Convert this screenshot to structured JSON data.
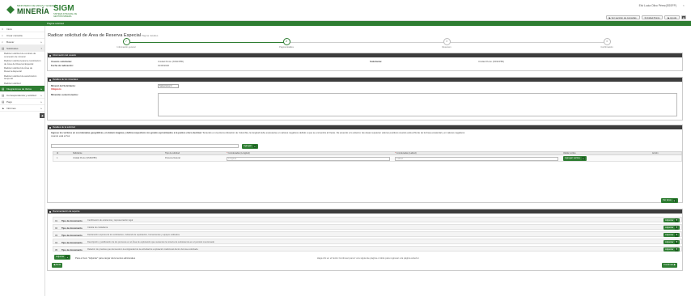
{
  "header": {
    "ministry": "MINISTERIO DE MINAS Y ENERGÍA",
    "brand": "MINERÍA",
    "app": "SIGM",
    "app_sub": "SISTEMA INTEGRAL DE GESTIÓN MINERA",
    "user": "Elvi Lucia Olivo Pérez(SSSFP)",
    "close": "×",
    "actions": [
      "▶ Ver sección de consultas",
      "ℹ Unidad Punto",
      "▶ Ayuda",
      "■"
    ]
  },
  "breadcrumb": "Página solicitud",
  "sidebar": {
    "items": [
      {
        "icon": "⌂",
        "label": "Inicio",
        "chev": ""
      },
      {
        "icon": "⌕",
        "label": "Crear consulta",
        "chev": ""
      },
      {
        "icon": "⌕",
        "label": "Buscar",
        "chev": "▸"
      },
      {
        "icon": "▤",
        "label": "Solicitudes",
        "chev": "▾"
      }
    ],
    "subitems": [
      "Radicar solicitud de contrato de concesión de mineral",
      "Radicar solicitud para la constitución de Área de Reserva Especial",
      "Radicar solicitud de Área de Reserva Especial",
      "Radicar solicitud de autorización temporal",
      "Radicar solicitud"
    ],
    "items2": [
      {
        "icon": "▤",
        "label": "Integraciones de títulos",
        "chev": "▸",
        "highlight": true
      },
      {
        "icon": "▤",
        "label": "Correspondencia y solicitud",
        "chev": "▸"
      },
      {
        "icon": "▤",
        "label": "Pago",
        "chev": "▸"
      },
      {
        "icon": "▲",
        "label": "Informes",
        "chev": "▸"
      }
    ],
    "collapse": "◀"
  },
  "page": {
    "title": "Radicar solicitud de Área de Reserva Especial",
    "subtitle": " Página detalles"
  },
  "stepper": [
    {
      "num": "✓",
      "label": "Información general",
      "done": true
    },
    {
      "num": "2",
      "label": "Página detalles",
      "done": true
    },
    {
      "num": "3",
      "label": "Resumen",
      "done": false
    },
    {
      "num": "4",
      "label": "Confirmación",
      "done": false
    }
  ],
  "info_panel": {
    "title": "Información del usuario",
    "user_label": "Usuario solicitante:",
    "user_value": "Unidad Punto (SSSFP85)",
    "date_label": "Fecha de radicación:",
    "date_value": "01/06/2020",
    "right_label": "Solicitante:",
    "right_value": "Unidad Punto (SSSFP85)"
  },
  "minerals_panel": {
    "title": "Detalles de los minerales",
    "mineral_label": "Mineral del Solicitante:",
    "mineral_req": "Obligatorio",
    "select_text": "Seleccionar ▾",
    "desc_label": "Minerales seleccionados:"
  },
  "area_panel": {
    "title": "Detalles de la solicitud",
    "hint_bold": "Ingrese los vértices en coordenadas geográficas, en datum magnas y defina respectivos los grados aproximados a la puntos cinco decimal.",
    "hint_rest": " Teniendo en cuenta la ubicación de Colombia, la longitud debe expresarse en valores negativos debido a que se encuentra al Oeste. De acuerdo a lo anterior, las áreas requieren valores positivos cuando está al Norte de la línea ecuatorial y en valores negativos cuando está al Sur.",
    "search_btn": "Agregar",
    "columns": [
      "Id",
      "Solicitante",
      "Tipo de solicitud",
      "Coordenadas (Longitud)",
      "Coordenadas (Latitud)",
      "Validar vértice",
      "Acción"
    ],
    "col_req": "Obligatorio",
    "row": {
      "id": "1",
      "name": "Unidad Punto (SSSFP85)",
      "type": "Persona Natural",
      "lon_ph": "Longitud",
      "lat_ph": "Latitud",
      "validate": "Agregar vértice"
    },
    "save_btn": "Ver área"
  },
  "docs_panel": {
    "title": "Documentación de soporte",
    "rows": [
      {
        "num": "01",
        "label": "Tipo de documento",
        "desc": "Certificación de existencia y representación legal",
        "btn": "Adjuntar"
      },
      {
        "num": "02",
        "label": "Tipo de documento",
        "desc": "Cédula de ciudadanía",
        "btn": "Adjuntar"
      },
      {
        "num": "03",
        "label": "Tipo de documento",
        "desc": "Declaración expresa de los solicitantes, indicando la explotación, herramientas y equipos utilizados",
        "btn": "Adjuntar"
      },
      {
        "num": "04",
        "label": "Tipo de documento",
        "desc": "Descripción y justificación de los procesos en el Área de explotación que sustentan la minería de subsistencia en el periodo mencionado",
        "btn": "Adjuntar"
      },
      {
        "num": "05",
        "label": "Tipo de documento",
        "desc": "Relación de pruebas que demuestren la antigüedad de la actividad de explotación tradicional dentro del área solicitada",
        "btn": "Adjuntar"
      }
    ],
    "add_btn": "Adjuntar",
    "add_note": "Para el ítem \"Adjuntar\" para cargar documentos adicionales"
  },
  "footer": {
    "note": "Haga clic en el botón Continuar para ir a la siguiente página o Atrás para regresar a la página anterior.",
    "back": "◀ Atrás",
    "next": "Continuar ▶"
  }
}
